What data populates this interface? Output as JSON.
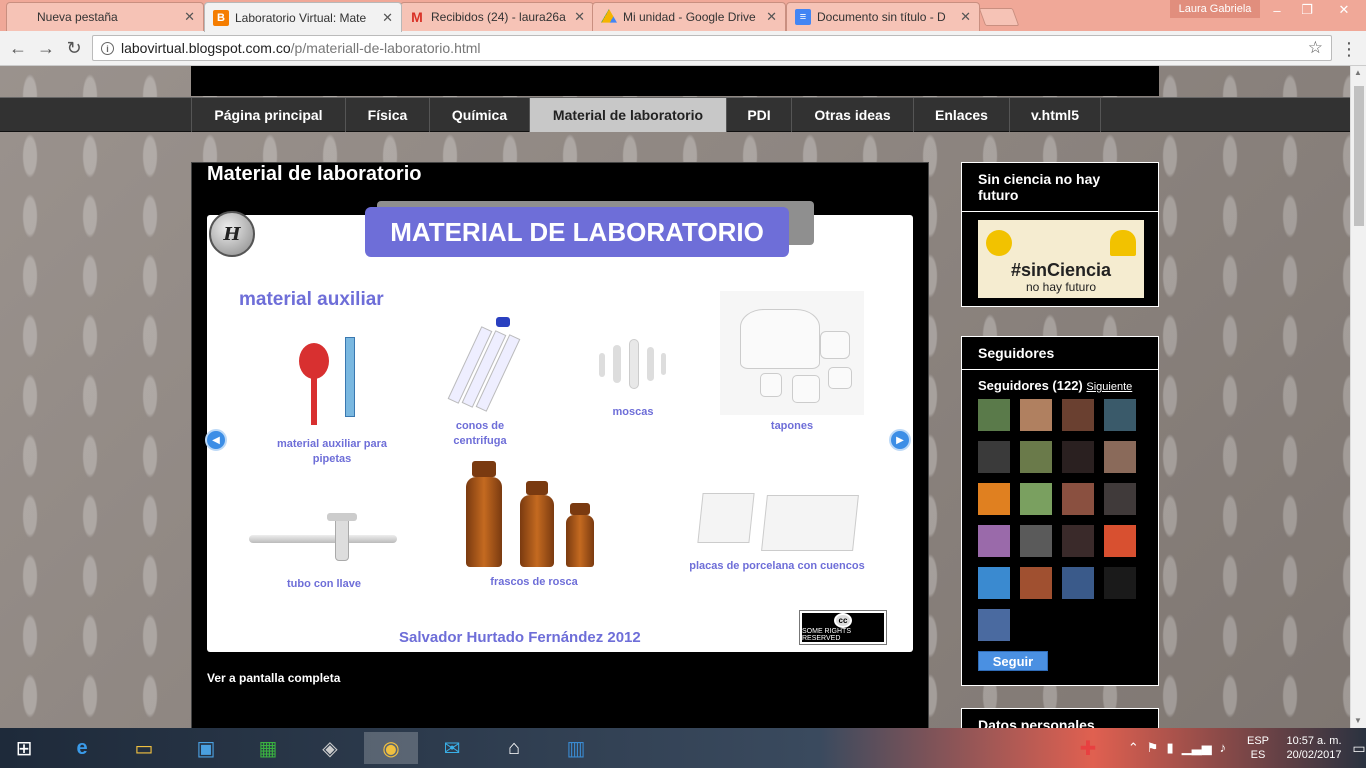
{
  "browser": {
    "tabs": [
      {
        "label": "Nueva pestaña",
        "icon": "blank-page-icon"
      },
      {
        "label": "Laboratorio Virtual: Mate",
        "icon": "blogger-icon"
      },
      {
        "label": "Recibidos (24) - laura26a",
        "icon": "gmail-icon"
      },
      {
        "label": "Mi unidad - Google Drive",
        "icon": "google-drive-icon"
      },
      {
        "label": "Documento sin título - D",
        "icon": "google-docs-icon"
      }
    ],
    "profile_name": "Laura Gabriela",
    "url_host": "labovirtual.blogspot.com.co",
    "url_path": "/p/materiall-de-laboratorio.html"
  },
  "site": {
    "nav": [
      {
        "label": "Página principal"
      },
      {
        "label": "Física"
      },
      {
        "label": "Química"
      },
      {
        "label": "Material de laboratorio"
      },
      {
        "label": "PDI"
      },
      {
        "label": "Otras ideas"
      },
      {
        "label": "Enlaces"
      },
      {
        "label": "v.html5"
      }
    ],
    "active_nav": "Material de laboratorio",
    "post_title": "Material de laboratorio",
    "slide": {
      "banner": "MATERIAL DE LABORATORIO",
      "logo_text": "H",
      "heading": "material auxiliar",
      "items": [
        {
          "caption": "material auxiliar para pipetas"
        },
        {
          "caption": "conos de centrifuga"
        },
        {
          "caption": "moscas"
        },
        {
          "caption": "tapones"
        },
        {
          "caption": "tubo con llave"
        },
        {
          "caption": "frascos de rosca"
        },
        {
          "caption": "placas de porcelana con cuencos"
        }
      ],
      "author": "Salvador Hurtado Fernández 2012",
      "license": "SOME RIGHTS RESERVED",
      "license_mark": "cc"
    },
    "fullscreen_link": "Ver a pantalla completa",
    "sidebar": {
      "widget1_title": "Sin ciencia no hay futuro",
      "badge_tag": "#sinCiencia",
      "badge_sub": "no hay futuro",
      "widget2_title": "Seguidores",
      "followers_label": "Seguidores (122)",
      "followers_next": "Siguiente",
      "follow_button": "Seguir",
      "widget3_title": "Datos personales",
      "avatar_colors": [
        "#5a7a4a",
        "#b08060",
        "#6a4030",
        "#3a5a6a",
        "#3a3a3a",
        "#6a7a4a",
        "#2a2020",
        "#8a6a5a",
        "#e08020",
        "#7aa060",
        "#8a5040",
        "#403a3a",
        "#9a6aaa",
        "#5a5a5a",
        "#3a2a2a",
        "#d85030",
        "#3a8ad0",
        "#a05030",
        "#3a5a8a",
        "#1a1a1a",
        "#4a6aa0"
      ]
    }
  },
  "taskbar": {
    "lang_top": "ESP",
    "lang_bottom": "ES",
    "time": "10:57 a. m.",
    "date": "20/02/2017"
  }
}
